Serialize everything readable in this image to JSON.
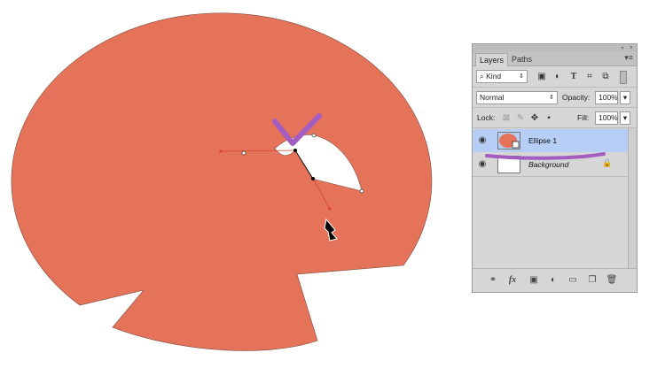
{
  "canvas": {
    "shape_color": "#e5735a",
    "annotation_color": "#a35cc0",
    "anchor_color": "#000000",
    "handle_color": "#d9452e"
  },
  "panel": {
    "collapse_glyph": "«",
    "close_glyph": "×",
    "menu_glyph": "▾≡",
    "tabs": [
      {
        "label": "Layers",
        "active": true
      },
      {
        "label": "Paths",
        "active": false
      }
    ],
    "filter": {
      "search_glyph": "⌕",
      "kind_label": "Kind",
      "kind_glyph": "⇕",
      "filter_icons": [
        "image-filter-icon",
        "adjustment-filter-icon",
        "type-filter-icon",
        "shape-filter-icon",
        "smart-object-filter-icon",
        "filter-toggle-icon"
      ]
    },
    "blend_mode": "Normal",
    "blend_glyph": "⇕",
    "opacity_label": "Opacity:",
    "opacity_value": "100%",
    "fill_label": "Fill:",
    "fill_value": "100%",
    "lock_label": "Lock:",
    "stepper_glyph": "▾",
    "layers": [
      {
        "name": "Ellipse 1",
        "selected": true,
        "visible": true,
        "locked": false
      },
      {
        "name": "Background",
        "selected": false,
        "visible": true,
        "locked": true
      }
    ],
    "eye_glyph": "◉",
    "lock_glyph": "🔒",
    "footer_icons": [
      "link-layers-icon",
      "fx-icon",
      "add-mask-icon",
      "adjustment-layer-icon",
      "new-group-icon",
      "new-layer-icon",
      "delete-layer-icon"
    ],
    "fx_label": "fx"
  }
}
